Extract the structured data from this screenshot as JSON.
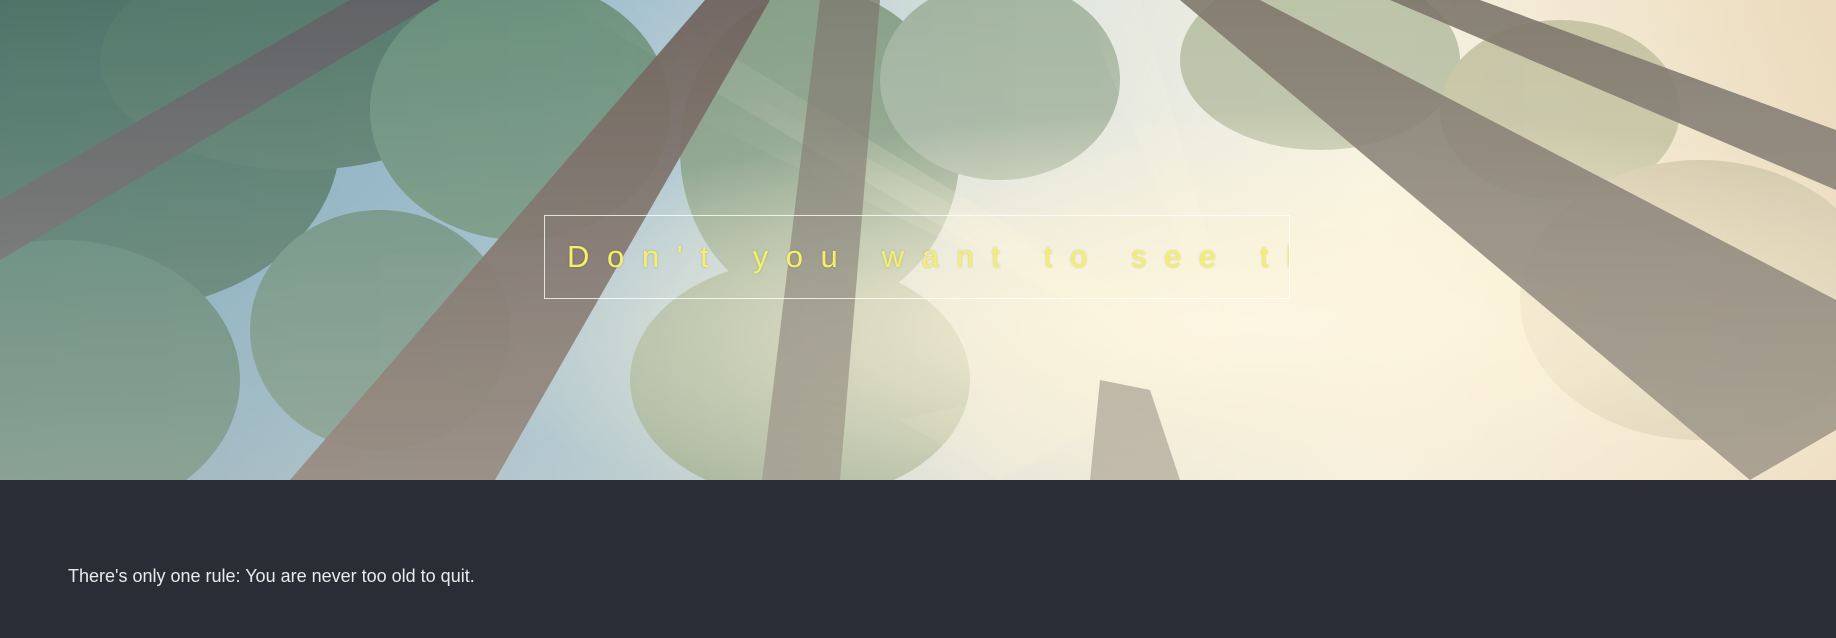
{
  "hero": {
    "image_subject": "looking-up-forest-canopy-sunbeams",
    "headline": "Don't you want to see this?",
    "headline_color": "#f4f06a"
  },
  "footer": {
    "quote": "There's only one rule: You are never too old to quit.",
    "background_color": "#2a2d35"
  }
}
